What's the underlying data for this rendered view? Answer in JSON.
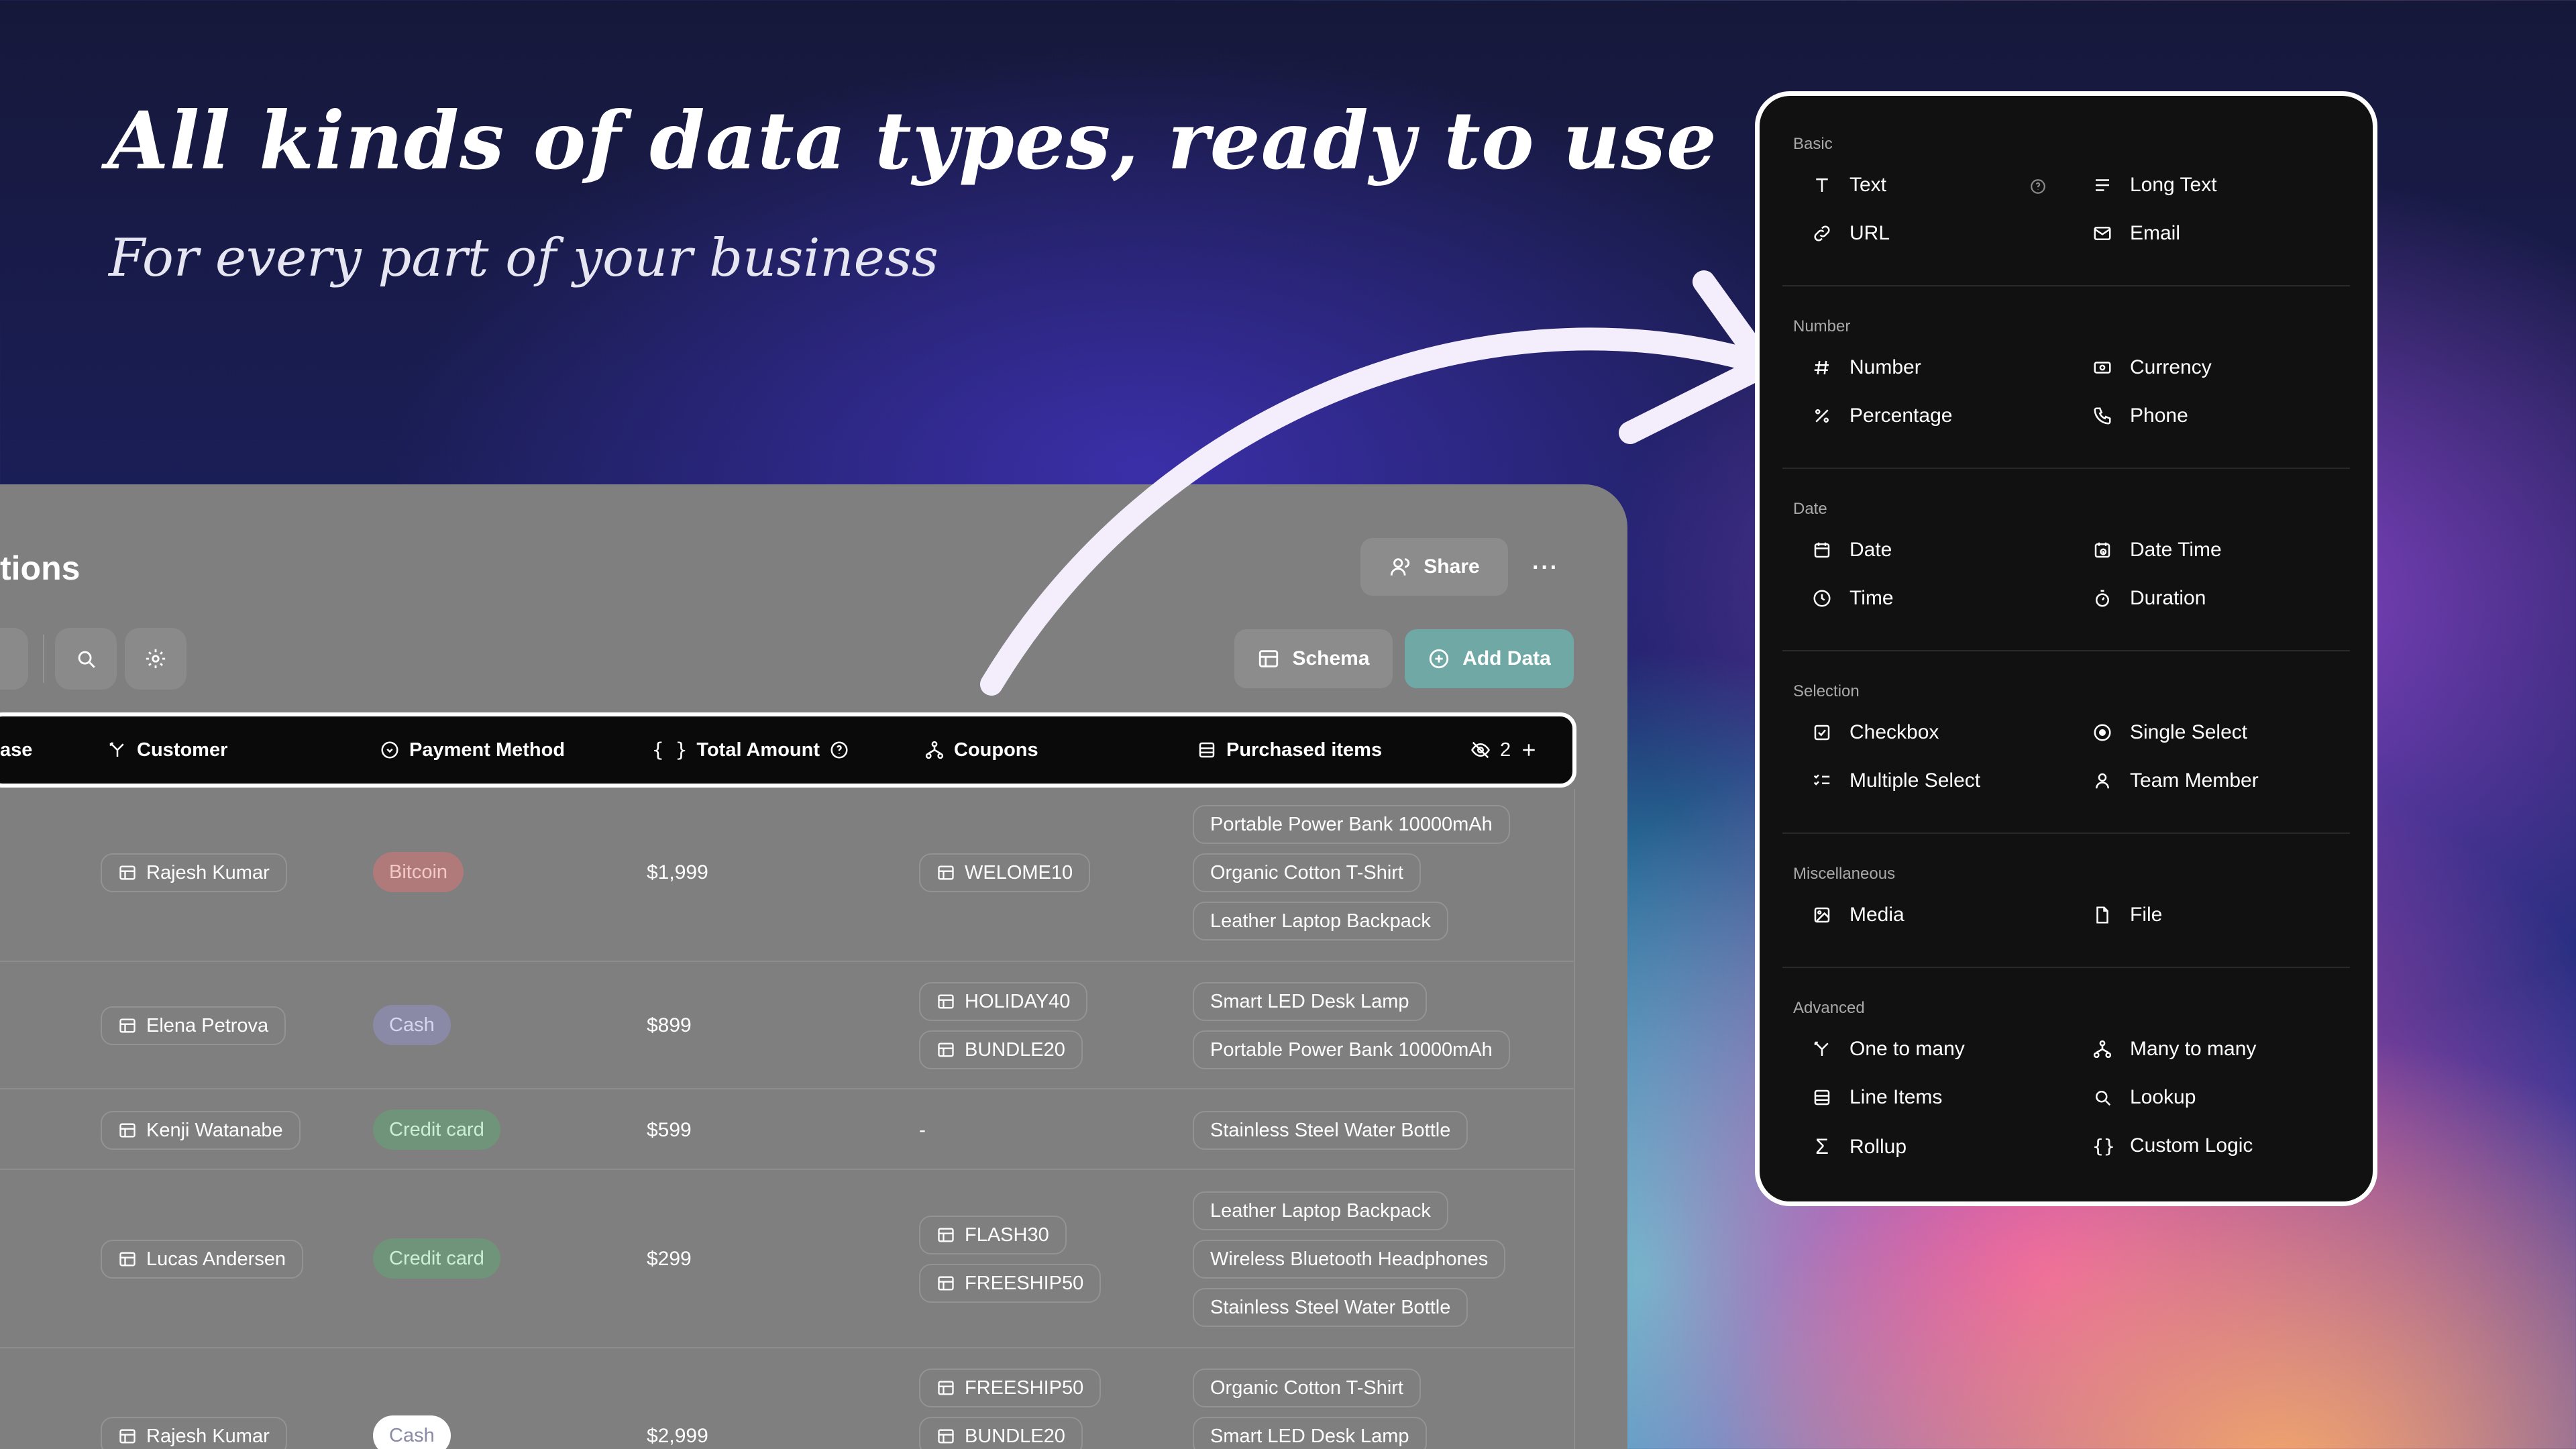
{
  "hero": {
    "title": "All kinds of data types, ready to use",
    "subtitle": "For every part of your business"
  },
  "table": {
    "title": "tions",
    "share_label": "Share",
    "schema_label": "Schema",
    "add_data_label": "Add Data",
    "columns": [
      "ase",
      "Customer",
      "Payment Method",
      "Total Amount",
      "Coupons",
      "Purchased items"
    ],
    "hidden_count": "2",
    "rows": [
      {
        "customer": "Rajesh Kumar",
        "payment": "Bitcoin",
        "amount": "$1,999",
        "coupons": [
          "WELOME10"
        ],
        "items": [
          "Portable Power Bank 10000mAh",
          "Organic Cotton T-Shirt",
          "Leather Laptop Backpack"
        ]
      },
      {
        "customer": "Elena Petrova",
        "payment": "Cash",
        "amount": "$899",
        "coupons": [
          "HOLIDAY40",
          "BUNDLE20"
        ],
        "items": [
          "Smart LED Desk Lamp",
          "Portable Power Bank 10000mAh"
        ]
      },
      {
        "customer": "Kenji Watanabe",
        "payment": "Credit card",
        "amount": "$599",
        "coupons": [],
        "coupon_empty": "-",
        "items": [
          "Stainless Steel Water Bottle"
        ]
      },
      {
        "customer": "Lucas Andersen",
        "payment": "Credit card",
        "amount": "$299",
        "coupons": [
          "FLASH30",
          "FREESHIP50"
        ],
        "items": [
          "Leather Laptop Backpack",
          "Wireless Bluetooth Headphones",
          "Stainless Steel Water Bottle"
        ]
      },
      {
        "customer": "Rajesh Kumar",
        "payment": "Cash",
        "amount": "$2,999",
        "coupons": [
          "FREESHIP50",
          "BUNDLE20"
        ],
        "items": [
          "Organic Cotton T-Shirt",
          "Smart LED Desk Lamp"
        ]
      }
    ]
  },
  "menu": {
    "sections": [
      {
        "label": "Basic",
        "items": [
          "Text",
          "Long Text",
          "URL",
          "Email"
        ]
      },
      {
        "label": "Number",
        "items": [
          "Number",
          "Currency",
          "Percentage",
          "Phone"
        ]
      },
      {
        "label": "Date",
        "items": [
          "Date",
          "Date Time",
          "Time",
          "Duration"
        ]
      },
      {
        "label": "Selection",
        "items": [
          "Checkbox",
          "Single Select",
          "Multiple Select",
          "Team Member"
        ]
      },
      {
        "label": "Miscellaneous",
        "items": [
          "Media",
          "File"
        ]
      },
      {
        "label": "Advanced",
        "items": [
          "One to many",
          "Many to many",
          "Line Items",
          "Lookup",
          "Rollup",
          "Custom Logic"
        ]
      }
    ]
  },
  "colors": {
    "bitcoin_pill": "#b07a7a",
    "cash_pill": "#8a8aa6",
    "credit_pill": "#6f9479",
    "add_data_btn": "#6fa8a4"
  }
}
